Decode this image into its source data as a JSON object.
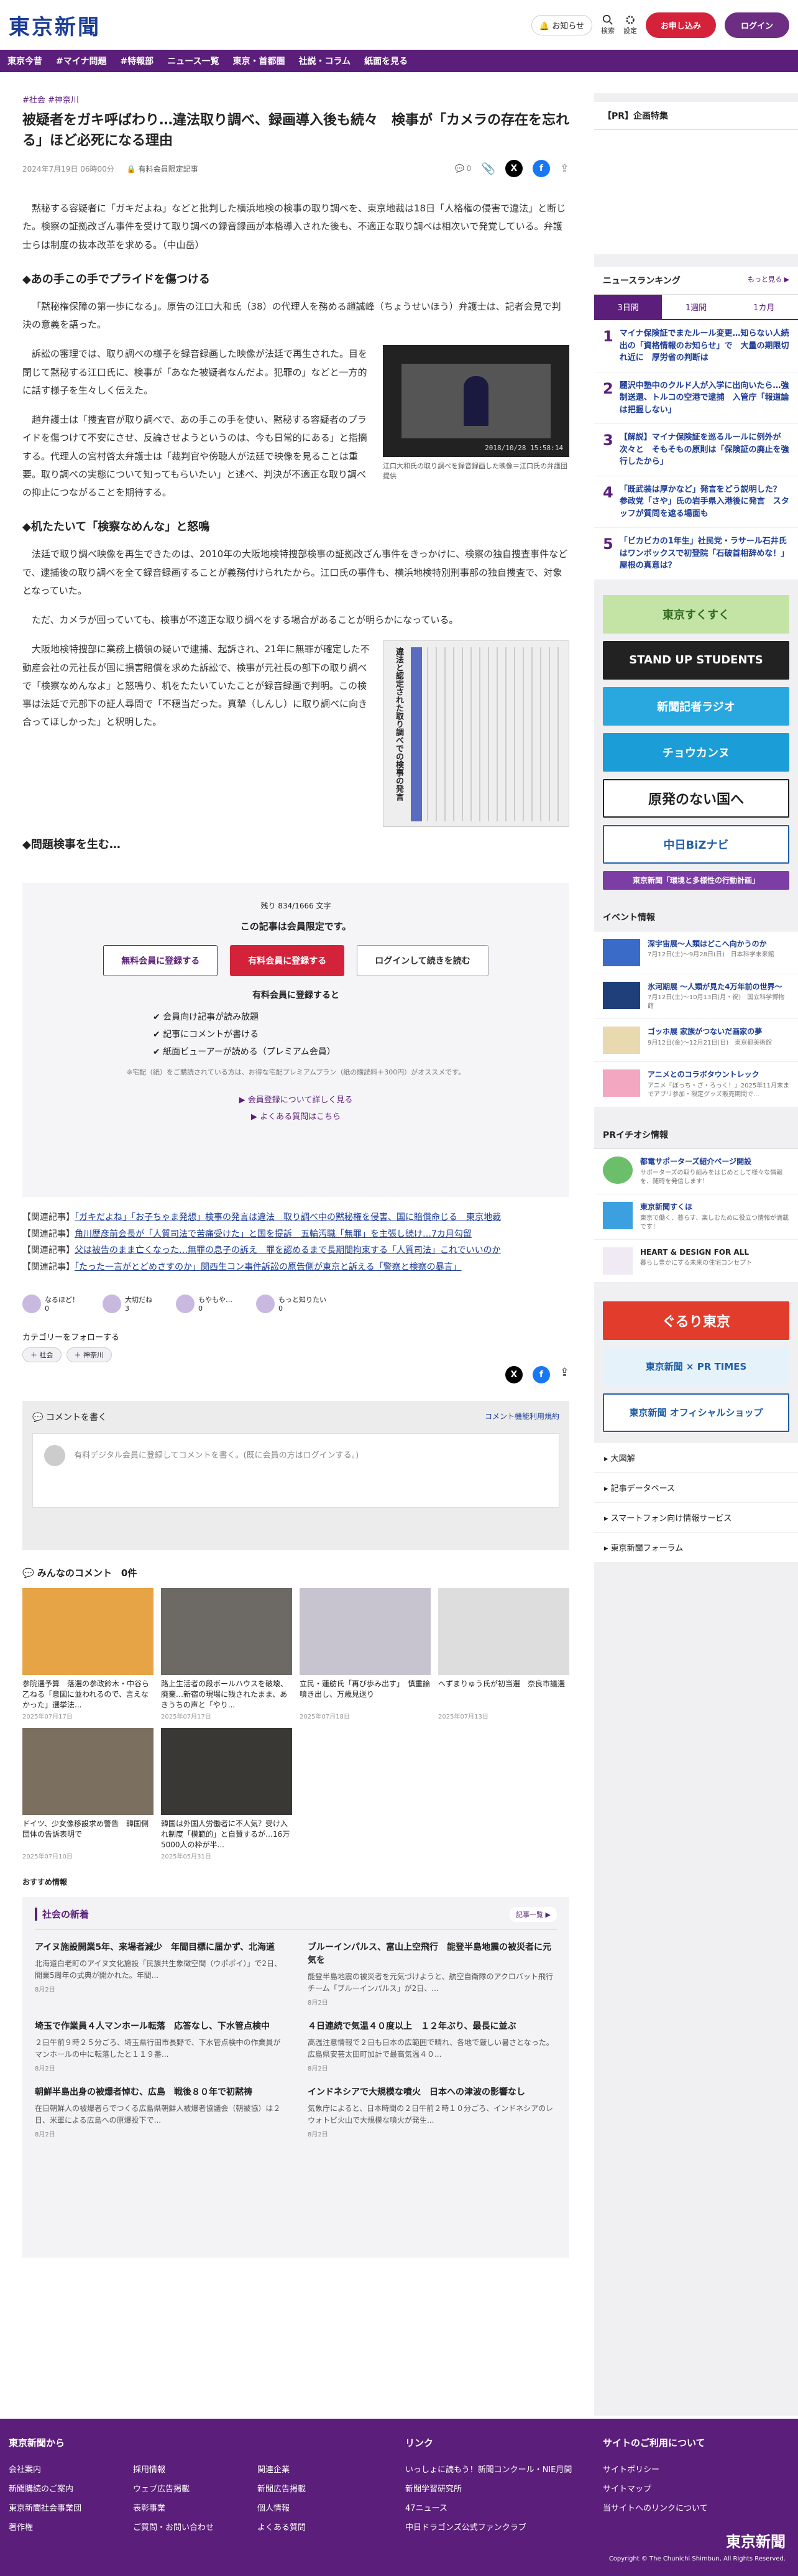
{
  "header": {
    "logo": "東京新聞",
    "notice": "お知らせ",
    "search": "検索",
    "settings": "設定",
    "register": "お申し込み",
    "login": "ログイン"
  },
  "nav": [
    "東京今昔",
    "#マイナ問題",
    "#特報部",
    "ニュース一覧",
    "東京・首都圏",
    "社説・コラム",
    "紙面を見る"
  ],
  "article": {
    "tags": "#社会 #神奈川",
    "title": "被疑者をガキ呼ばわり…違法取り調べ、録画導入後も続々　検事が「カメラの存在を忘れる」ほど必死になる理由",
    "date": "2024年7月19日 06時00分",
    "member": "有料会員限定記事",
    "comment_count": "0",
    "lead": "黙秘する容疑者に「ガキだよね」などと批判した横浜地検の検事の取り調べを、東京地裁は18日「人格権の侵害で違法」と断じた。検察の証拠改ざん事件を受けて取り調べの録音録画が本格導入された後も、不適正な取り調べは相次いで発覚している。弁護士らは制度の抜本改革を求める。（中山岳）",
    "h_1": "◆あの手この手でプライドを傷つける",
    "p1": "「黙秘権保障の第一歩になる」。原告の江口大和氏（38）の代理人を務める趙誠峰（ちょうせいほう）弁護士は、記者会見で判決の意義を語った。",
    "p2": "訴訟の審理では、取り調べの様子を録音録画した映像が法廷で再生された。目を閉じて黙秘する江口氏に、検事が「あなた被疑者なんだよ。犯罪の」などと一方的に話す様子を生々しく伝えた。",
    "p3": "趙弁護士は「捜査官が取り調べで、あの手この手を使い、黙秘する容疑者のプライドを傷つけて不安にさせ、反論させようというのは、今も日常的にある」と指摘する。代理人の宮村啓太弁護士は「裁判官や傍聴人が法廷で映像を見ることは重要。取り調べの実態について知ってもらいたい」と述べ、判決が不適正な取り調べの抑止につながることを期待する。",
    "fig_caption": "江口大和氏の取り調べを録音録画した映像＝江口氏の弁護団提供",
    "fig_stamp": "2018/10/28  15:58:14",
    "h_2": "◆机たたいて「検察なめんな」と怒鳴",
    "p4": "法廷で取り調べ映像を再生できたのは、2010年の大阪地検特捜部検事の証拠改ざん事件をきっかけに、検察の独自捜査事件などで、逮捕後の取り調べを全て録音録画することが義務付けられたから。江口氏の事件も、横浜地検特別刑事部の独自捜査で、対象となっていた。",
    "p5": "ただ、カメラが回っていても、検事が不適正な取り調べをする場合があることが明らかになっている。",
    "p6": "大阪地検特捜部に業務上横領の疑いで逮捕、起訴され、21年に無罪が確定した不動産会社の元社長が国に損害賠償を求めた訴訟で、検事が元社長の部下の取り調べで「検察なめんなよ」と怒鳴り、机をたたいていたことが録音録画で判明。この検事は法廷で元部下の証人尋問で「不穏当だった。真摯（しんし）に取り調べに向き合ってほしかった」と釈明した。",
    "fig2_title": "違法と認定された取り調べでの検事の発言",
    "h_3": "◆問題検事を生む…",
    "remain": "残り 834/1666 文字",
    "members_only": "この記事は会員限定です。",
    "btn_free": "無料会員に登録する",
    "btn_paid": "有料会員に登録する",
    "btn_login": "ログインして続きを読む",
    "benefit_title": "有料会員に登録すると",
    "benefits": [
      "会員向け記事が読み放題",
      "記事にコメントが書ける",
      "紙面ビューアーが読める（プレミアム会員）"
    ],
    "note": "※宅配（紙）をご購読されている方は、お得な宅配プレミアムプラン（紙の購読料＋300円）がオススメです。",
    "link_detail": "会員登録について詳しく見る",
    "link_faq": "よくある質問はこちら",
    "related": [
      {
        "pre": "【関連記事】",
        "link": "「ガキだよね」「お子ちゃま発想」検事の発言は違法　取り調べ中の黙秘権を侵害、国に賠償命じる　東京地裁"
      },
      {
        "pre": "【関連記事】",
        "link": "角川歴彦前会長が「人質司法で苦痛受けた」と国を提訴　五輪汚職「無罪」を主張し続け…7カ月勾留"
      },
      {
        "pre": "【関連記事】",
        "link": "父は被告のまま亡くなった…無罪の息子の訴え　罪を認めるまで長期間拘束する「人質司法」これでいいのか"
      },
      {
        "pre": "【関連記事】",
        "link": "「たった一言がとどめさすのか」関西生コン事件訴訟の原告側が東京と訴える「警察と検察の暴言」"
      }
    ],
    "reactions": [
      {
        "l": "なるほど！",
        "n": "0"
      },
      {
        "l": "大切だね",
        "n": "3"
      },
      {
        "l": "もやもや…",
        "n": "0"
      },
      {
        "l": "もっと知りたい",
        "n": "0"
      }
    ],
    "follow": "カテゴリーをフォローする",
    "follow_tags": [
      "社会",
      "神奈川"
    ],
    "comment_write": "コメントを書く",
    "comment_rule": "コメント機能利用規約",
    "comment_prompt": "有料デジタル会員に登録してコメントを書く。(既に会員の方はログインする。)",
    "all_comments": "みんなのコメント　0件"
  },
  "cards": [
    {
      "t": "参院選予算　落選の参政鈴木・中谷ら乙ねる「意図に並われるので、言えなかった」選挙法...",
      "d": "2025年07月17日"
    },
    {
      "t": "路上生活者の段ボールハウスを破壊、廃棄…新宿の現場に残されたまま、あきうちの声と「やり...",
      "d": "2025年07月17日"
    },
    {
      "t": "立民・蓮舫氏「再び歩み出す」　慎重論噴き出し、万歳見送り",
      "d": "2025年07月18日"
    },
    {
      "t": "へずまりゅう氏が初当選　奈良市議選",
      "d": "2025年07月13日"
    },
    {
      "t": "ドイツ、少女像移設求め警告　韓国側団体の告訴表明で",
      "d": "2025年07月10日"
    },
    {
      "t": "韓国は外国人労働者に不人気？受け入れ制度「模範的」と自賛するが…16万5000人の枠が半...",
      "d": "2025年05月31日"
    }
  ],
  "recommend": "おすすめ情報",
  "news": {
    "title": "社会の新着",
    "more": "記事一覧",
    "items": [
      {
        "t": "アイヌ施設開業5年、来場者減少　年間目標に届かず、北海道",
        "s": "北海道白老町のアイヌ文化施設「民族共生象徴空間（ウポポイ）」で2日、開業5周年の式典が開かれた。年間...",
        "d": "8月2日"
      },
      {
        "t": "ブルーインパルス、富山上空飛行　能登半島地震の被災者に元気を",
        "s": "能登半島地震の被災者を元気づけようと、航空自衛隊のアクロバット飛行チーム「ブルーインパルス」が2日、...",
        "d": "8月2日"
      },
      {
        "t": "埼玉で作業員４人マンホール転落　応答なし、下水管点検中",
        "s": "２日午前９時２５分ごろ、埼玉県行田市長野で、下水管点検中の作業員がマンホールの中に転落したと１１９番...",
        "d": "8月2日"
      },
      {
        "t": "４日連続で気温４０度以上　１２年ぶり、最長に並ぶ",
        "s": "高温注意情報で２日も日本の広範囲で晴れ、各地で厳しい暑さとなった。広島県安芸太田町加計で最高気温４０...",
        "d": "8月2日"
      },
      {
        "t": "朝鮮半島出身の被爆者悼む、広島　戦後８０年で初黙祷",
        "s": "在日朝鮮人の被爆者らでつくる広島県朝鮮人被爆者協議会（朝被協）は２日、米軍による広島への原爆投下で...",
        "d": "8月2日"
      },
      {
        "t": "インドネシアで大規模な噴火　日本への津波の影響なし",
        "s": "気象庁によると、日本時間の２日午前２時１０分ごろ、インドネシアのレウォトビ火山で大規模な噴火が発生...",
        "d": "8月2日"
      }
    ]
  },
  "side": {
    "pr": "【PR】企画特集",
    "rank_title": "ニュースランキング",
    "rank_more": "もっと見る",
    "tabs": [
      "3日間",
      "1週間",
      "1カ月"
    ],
    "ranking": [
      "マイナ保険証でまたルール変更…知らない人続出の「資格情報のお知らせ」で　大量の期限切れ近に　厚労省の判断は",
      "麗沢中塾中のクルド人が入学に出向いたら…強制送還、トルコの空港で逮捕　入管庁「報道論は把握しない」",
      "【解説】マイナ保険証を巡るルールに例外が次々と　そもそもの原則は「保険証の廃止を強行したから」",
      "「既武装は厚かなど」発言をどう説明した？　参政党「さや」氏の岩手県入港後に発言　スタッフが質問を遮る場面も",
      "「ビカビカの1年生」社民党・ラサール石井氏はワンボックスで初登院「石破首相辞めな！」屋根の真意は？"
    ],
    "banners": [
      "東京すくすく",
      "STAND UP STUDENTS",
      "新聞記者ラジオ",
      "チョウカンヌ",
      "原発のない国へ",
      "中日BiZナビ",
      "東京新聞「環境と多様性の行動計画」"
    ],
    "event_title": "イベント情報",
    "events": [
      {
        "t": "深宇宙展〜人類はどこへ向かうのか",
        "s": "7月12日(土)〜9月28日(日)　日本科学未来館"
      },
      {
        "t": "氷河期展 〜人類が見た4万年前の世界〜",
        "s": "7月12日(土)〜10月13日(月・祝)　国立科学博物館"
      },
      {
        "t": "ゴッホ展 家族がつないだ画家の夢",
        "s": "9月12日(金)〜12月21日(日)　東京都美術館"
      },
      {
        "t": "アニメとのコラボタウントレック",
        "s": "アニメ『ぼっち・ざ・ろっく！』2025年11月末までアプリ参加・限定グッズ販売期間で..."
      }
    ],
    "pr_title": "PRイチオシ情報",
    "pr_items": [
      {
        "t": "都電サポーターズ紹介ページ開設",
        "s": "サポーターズの取り組みをはじめとして様々な情報を、随時を発信します！"
      },
      {
        "t": "東京新聞すくほ",
        "s": "東京で働く、暮らす、楽しむために役立つ情報が満載です！"
      },
      {
        "t": "HEART & DESIGN FOR ALL",
        "s": "暮らし豊かにする未来の住宅コンセプト"
      }
    ],
    "banners2": [
      "ぐるり東京",
      "東京新聞 × PR TIMES",
      "東京新聞 オフィシャルショップ"
    ],
    "links": [
      "大図解",
      "記事データベース",
      "スマートフォン向け情報サービス",
      "東京新聞フォーラム"
    ]
  },
  "footer": {
    "c1_title": "東京新聞から",
    "c1": [
      "会社案内",
      "採用情報",
      "関連企業",
      "新聞購読のご案内",
      "ウェブ広告掲載",
      "新聞広告掲載",
      "東京新聞社会事業団",
      "表彰事業",
      "個人情報",
      "著作権",
      "ご質問・お問い合わせ",
      "よくある質問"
    ],
    "c2_title": "リンク",
    "c2": [
      "いっしょに読もう！新聞コンクール・NIE月間",
      "新聞学習研究所",
      "47ニュース",
      "中日ドラゴンズ公式ファンクラブ"
    ],
    "c3_title": "サイトのご利用について",
    "c3": [
      "サイトポリシー",
      "サイトマップ",
      "当サイトへのリンクについて"
    ],
    "logo": "東京新聞",
    "copy": "Copyright © The Chunichi Shimbun, All Rights Reserved."
  }
}
